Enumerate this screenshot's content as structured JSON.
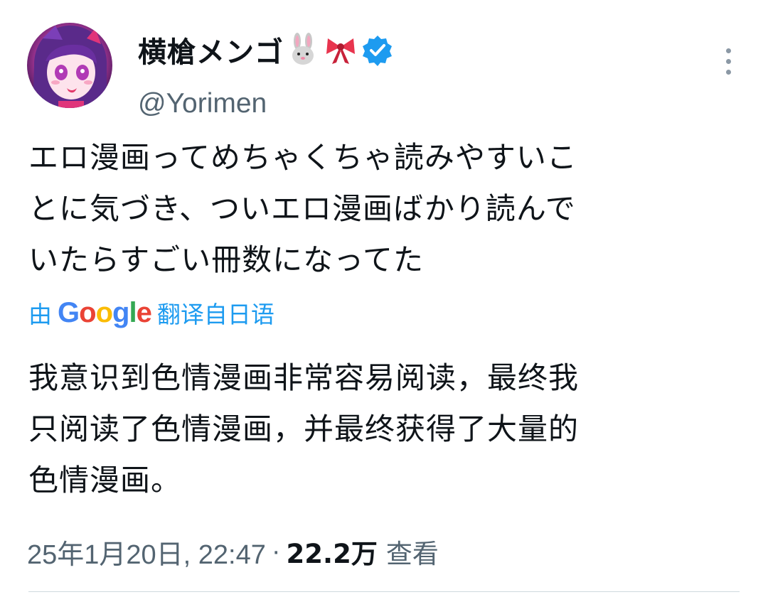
{
  "author": {
    "display_name": "横槍メンゴ",
    "handle": "@Yorimen",
    "name_emojis": [
      "rabbit-face-emoji",
      "ribbon-emoji"
    ],
    "verified": true
  },
  "tweet": {
    "lines": [
      "エロ漫画ってめちゃくちゃ読みやすいこ",
      "とに気づき、ついエロ漫画ばかり読んで",
      "いたらすごい冊数になってた"
    ]
  },
  "translation": {
    "prefix": "由",
    "provider": "Google",
    "suffix": "翻译自日语",
    "lines": [
      "我意识到色情漫画非常容易阅读，最终我",
      "只阅读了色情漫画，并最终获得了大量的",
      "色情漫画。"
    ]
  },
  "meta": {
    "timestamp": "25年1月20日, 22:47",
    "separator": "·",
    "views_count": "22.2万",
    "views_label": "查看"
  },
  "colors": {
    "link": "#1d9bf0",
    "secondary_text": "#536471",
    "primary_text": "#0f1419",
    "verified_badge": "#1d9bf0"
  }
}
